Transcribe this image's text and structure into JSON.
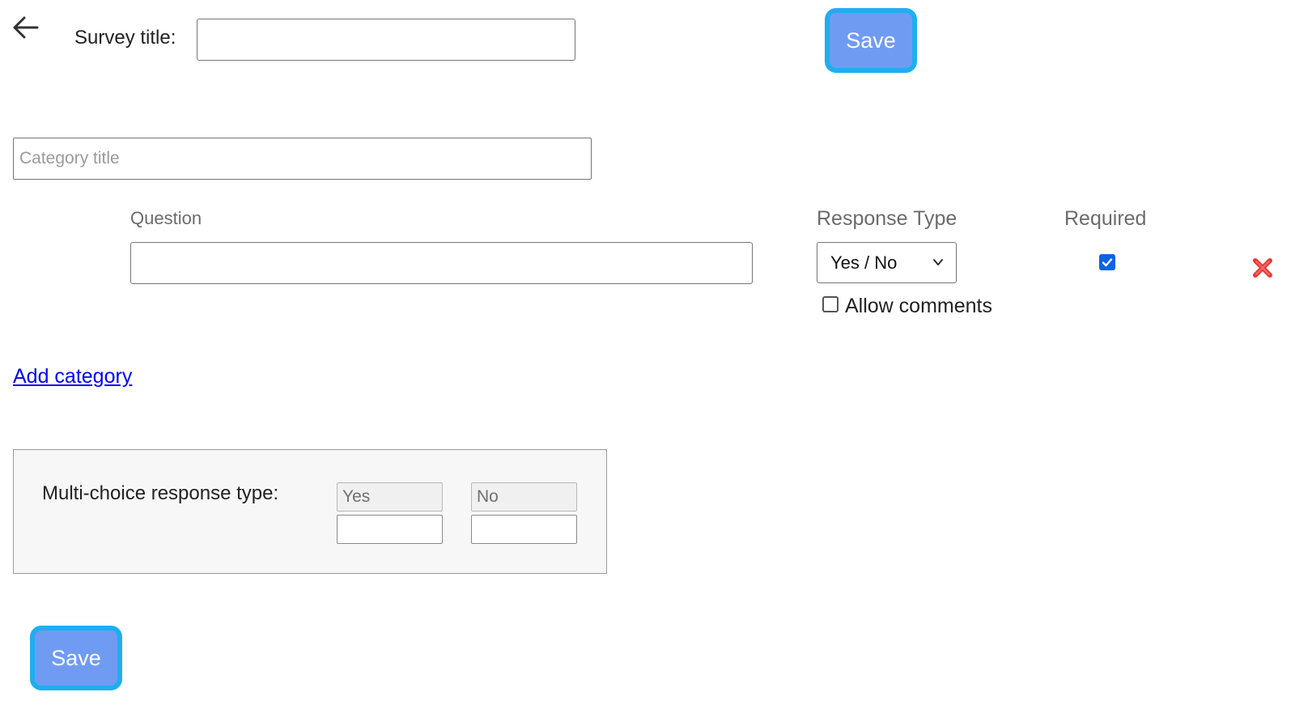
{
  "header": {
    "back_icon": "arrow-left-icon",
    "survey_title_label": "Survey title:",
    "survey_title_value": "",
    "save_label": "Save"
  },
  "category": {
    "title_placeholder": "Category title",
    "title_value": ""
  },
  "question_row": {
    "question_label": "Question",
    "question_value": "",
    "response_type_label": "Response Type",
    "response_type_selected": "Yes / No",
    "required_label": "Required",
    "required_checked": true,
    "allow_comments_label": "Allow comments",
    "allow_comments_checked": false,
    "delete_icon": "red-x-delete-icon"
  },
  "add_category_label": "Add category",
  "multi_choice": {
    "label": "Multi-choice response type:",
    "options": [
      {
        "preset": "Yes",
        "custom": ""
      },
      {
        "preset": "No",
        "custom": ""
      }
    ]
  },
  "footer": {
    "save_label": "Save"
  },
  "colors": {
    "save_bg": "#6f9cf2",
    "save_border": "#1eaef0",
    "link": "#0000ee",
    "checkbox": "#0b63e5",
    "delete": "#e53935"
  }
}
